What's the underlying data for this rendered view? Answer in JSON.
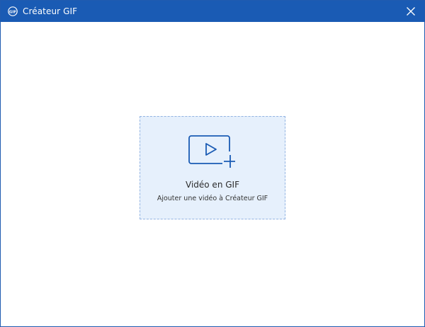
{
  "window": {
    "title": "Créateur GIF",
    "accent_color": "#1a5bb4"
  },
  "icons": {
    "app": "gif-app-icon",
    "close": "close-icon",
    "video_add": "video-add-icon"
  },
  "dropzone": {
    "title": "Vidéo en GIF",
    "subtitle": "Ajouter une vidéo à Créateur GIF",
    "background_color": "#e6f0fc",
    "icon_color": "#1a5bb4"
  }
}
